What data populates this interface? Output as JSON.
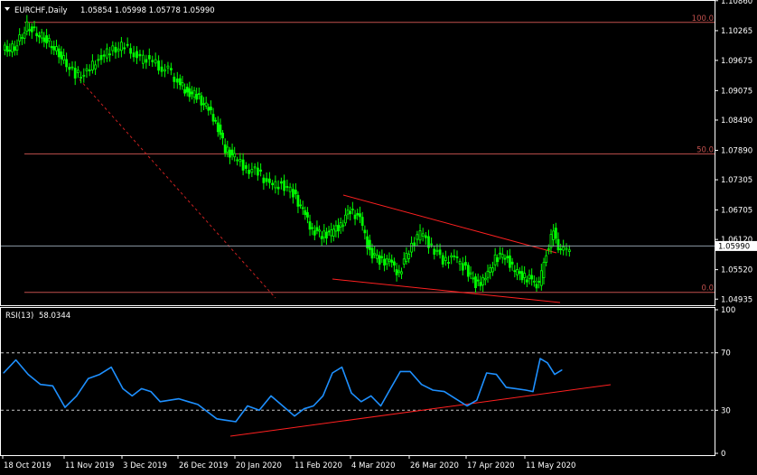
{
  "header": {
    "symbol": "EURCHF,Daily",
    "ohlc": "1.05854 1.05998 1.05778 1.05990"
  },
  "rsi_header": {
    "label": "RSI(13)",
    "value": "58.0344"
  },
  "current_price_label": "1.05990",
  "fib_labels": [
    {
      "text": "100.0",
      "price": 1.1043
    },
    {
      "text": "50.0",
      "price": 1.0782
    },
    {
      "text": "0.0",
      "price": 1.0507
    }
  ],
  "colors": {
    "background": "#000000",
    "candles": "#00ff00",
    "rsi_line": "#1e90ff",
    "trendline": "#ff2020",
    "fib_line": "#c0504d",
    "grid_frame": "#ffffff",
    "current_price_line": "#8c9aa6"
  },
  "chart_data": [
    {
      "type": "candlestick",
      "symbol": "EURCHF",
      "timeframe": "Daily",
      "ylim": [
        1.0485,
        1.1082
      ],
      "y_ticks": [
        "1.10860",
        "1.10265",
        "1.09675",
        "1.09075",
        "1.08490",
        "1.07890",
        "1.07305",
        "1.06705",
        "1.06120",
        "1.05520",
        "1.04935"
      ],
      "x_ticks": [
        "18 Oct 2019",
        "11 Nov 2019",
        "3 Dec 2019",
        "26 Dec 2019",
        "20 Jan 2020",
        "11 Feb 2020",
        "4 Mar 2020",
        "26 Mar 2020",
        "17 Apr 2020",
        "11 May 2020"
      ],
      "close_series": [
        {
          "date": "18 Oct 2019",
          "close": 1.0992
        },
        {
          "date": "23 Oct 2019",
          "close": 1.1035
        },
        {
          "date": "28 Oct 2019",
          "close": 1.1018
        },
        {
          "date": "1 Nov 2019",
          "close": 1.0998
        },
        {
          "date": "6 Nov 2019",
          "close": 1.0968
        },
        {
          "date": "11 Nov 2019",
          "close": 1.0938
        },
        {
          "date": "14 Nov 2019",
          "close": 1.0942
        },
        {
          "date": "19 Nov 2019",
          "close": 1.0972
        },
        {
          "date": "25 Nov 2019",
          "close": 1.0985
        },
        {
          "date": "29 Nov 2019",
          "close": 1.0995
        },
        {
          "date": "3 Dec 2019",
          "close": 1.0988
        },
        {
          "date": "5 Dec 2019",
          "close": 1.0968
        },
        {
          "date": "10 Dec 2019",
          "close": 1.0972
        },
        {
          "date": "13 Dec 2019",
          "close": 1.0955
        },
        {
          "date": "17 Dec 2019",
          "close": 1.0948
        },
        {
          "date": "20 Dec 2019",
          "close": 1.0925
        },
        {
          "date": "26 Dec 2019",
          "close": 1.0905
        },
        {
          "date": "30 Dec 2019",
          "close": 1.0898
        },
        {
          "date": "3 Jan 2020",
          "close": 1.0875
        },
        {
          "date": "8 Jan 2020",
          "close": 1.0848
        },
        {
          "date": "13 Jan 2020",
          "close": 1.0792
        },
        {
          "date": "16 Jan 2020",
          "close": 1.0775
        },
        {
          "date": "20 Jan 2020",
          "close": 1.0752
        },
        {
          "date": "24 Jan 2020",
          "close": 1.0748
        },
        {
          "date": "29 Jan 2020",
          "close": 1.0718
        },
        {
          "date": "3 Feb 2020",
          "close": 1.0722
        },
        {
          "date": "6 Feb 2020",
          "close": 1.0705
        },
        {
          "date": "11 Feb 2020",
          "close": 1.0668
        },
        {
          "date": "14 Feb 2020",
          "close": 1.0632
        },
        {
          "date": "19 Feb 2020",
          "close": 1.0622
        },
        {
          "date": "24 Feb 2020",
          "close": 1.0625
        },
        {
          "date": "28 Feb 2020",
          "close": 1.0642
        },
        {
          "date": "2 Mar 2020",
          "close": 1.0672
        },
        {
          "date": "4 Mar 2020",
          "close": 1.0652
        },
        {
          "date": "9 Mar 2020",
          "close": 1.0588
        },
        {
          "date": "12 Mar 2020",
          "close": 1.0572
        },
        {
          "date": "17 Mar 2020",
          "close": 1.0568
        },
        {
          "date": "20 Mar 2020",
          "close": 1.0545
        },
        {
          "date": "24 Mar 2020",
          "close": 1.0592
        },
        {
          "date": "26 Mar 2020",
          "close": 1.0625
        },
        {
          "date": "31 Mar 2020",
          "close": 1.0598
        },
        {
          "date": "3 Apr 2020",
          "close": 1.0572
        },
        {
          "date": "8 Apr 2020",
          "close": 1.0575
        },
        {
          "date": "13 Apr 2020",
          "close": 1.0555
        },
        {
          "date": "17 Apr 2020",
          "close": 1.0525
        },
        {
          "date": "22 Apr 2020",
          "close": 1.0532
        },
        {
          "date": "27 Apr 2020",
          "close": 1.0575
        },
        {
          "date": "30 Apr 2020",
          "close": 1.0582
        },
        {
          "date": "5 May 2020",
          "close": 1.0548
        },
        {
          "date": "8 May 2020",
          "close": 1.0538
        },
        {
          "date": "11 May 2020",
          "close": 1.0532
        },
        {
          "date": "14 May 2020",
          "close": 1.052
        },
        {
          "date": "18 May 2020",
          "close": 1.0588
        },
        {
          "date": "20 May 2020",
          "close": 1.0628
        },
        {
          "date": "22 May 2020",
          "close": 1.0585
        },
        {
          "date": "26 May 2020",
          "close": 1.0599
        }
      ],
      "fibonacci_levels": [
        {
          "level": "100.0",
          "price": 1.1043
        },
        {
          "level": "50.0",
          "price": 1.0782
        },
        {
          "level": "0.0",
          "price": 1.0507
        }
      ],
      "current_price": 1.0599
    },
    {
      "type": "line",
      "name": "RSI(13)",
      "ylim": [
        0,
        100
      ],
      "y_ticks": [
        100,
        70,
        30,
        0
      ],
      "levels": [
        70,
        30
      ],
      "last_value": 58.0344,
      "series": [
        {
          "date": "18 Oct 2019",
          "value": 56
        },
        {
          "date": "23 Oct 2019",
          "value": 65
        },
        {
          "date": "28 Oct 2019",
          "value": 55
        },
        {
          "date": "1 Nov 2019",
          "value": 48
        },
        {
          "date": "6 Nov 2019",
          "value": 47
        },
        {
          "date": "11 Nov 2019",
          "value": 32
        },
        {
          "date": "14 Nov 2019",
          "value": 40
        },
        {
          "date": "19 Nov 2019",
          "value": 52
        },
        {
          "date": "25 Nov 2019",
          "value": 55
        },
        {
          "date": "29 Nov 2019",
          "value": 60
        },
        {
          "date": "3 Dec 2019",
          "value": 45
        },
        {
          "date": "5 Dec 2019",
          "value": 40
        },
        {
          "date": "10 Dec 2019",
          "value": 45
        },
        {
          "date": "13 Dec 2019",
          "value": 43
        },
        {
          "date": "17 Dec 2019",
          "value": 36
        },
        {
          "date": "20 Dec 2019",
          "value": 37
        },
        {
          "date": "26 Dec 2019",
          "value": 38
        },
        {
          "date": "30 Dec 2019",
          "value": 36
        },
        {
          "date": "3 Jan 2020",
          "value": 34
        },
        {
          "date": "8 Jan 2020",
          "value": 29
        },
        {
          "date": "13 Jan 2020",
          "value": 24
        },
        {
          "date": "16 Jan 2020",
          "value": 23
        },
        {
          "date": "20 Jan 2020",
          "value": 22
        },
        {
          "date": "24 Jan 2020",
          "value": 33
        },
        {
          "date": "29 Jan 2020",
          "value": 30
        },
        {
          "date": "3 Feb 2020",
          "value": 40
        },
        {
          "date": "6 Feb 2020",
          "value": 33
        },
        {
          "date": "11 Feb 2020",
          "value": 26
        },
        {
          "date": "14 Feb 2020",
          "value": 31
        },
        {
          "date": "19 Feb 2020",
          "value": 33
        },
        {
          "date": "24 Feb 2020",
          "value": 40
        },
        {
          "date": "28 Feb 2020",
          "value": 56
        },
        {
          "date": "2 Mar 2020",
          "value": 60
        },
        {
          "date": "4 Mar 2020",
          "value": 42
        },
        {
          "date": "9 Mar 2020",
          "value": 36
        },
        {
          "date": "12 Mar 2020",
          "value": 40
        },
        {
          "date": "17 Mar 2020",
          "value": 33
        },
        {
          "date": "20 Mar 2020",
          "value": 45
        },
        {
          "date": "24 Mar 2020",
          "value": 57
        },
        {
          "date": "26 Mar 2020",
          "value": 57
        },
        {
          "date": "31 Mar 2020",
          "value": 48
        },
        {
          "date": "3 Apr 2020",
          "value": 44
        },
        {
          "date": "8 Apr 2020",
          "value": 43
        },
        {
          "date": "13 Apr 2020",
          "value": 38
        },
        {
          "date": "17 Apr 2020",
          "value": 33
        },
        {
          "date": "22 Apr 2020",
          "value": 37
        },
        {
          "date": "27 Apr 2020",
          "value": 56
        },
        {
          "date": "30 Apr 2020",
          "value": 55
        },
        {
          "date": "5 May 2020",
          "value": 46
        },
        {
          "date": "8 May 2020",
          "value": 45
        },
        {
          "date": "11 May 2020",
          "value": 44
        },
        {
          "date": "14 May 2020",
          "value": 43
        },
        {
          "date": "18 May 2020",
          "value": 66
        },
        {
          "date": "20 May 2020",
          "value": 63
        },
        {
          "date": "22 May 2020",
          "value": 55
        },
        {
          "date": "26 May 2020",
          "value": 58.0344
        }
      ]
    }
  ]
}
